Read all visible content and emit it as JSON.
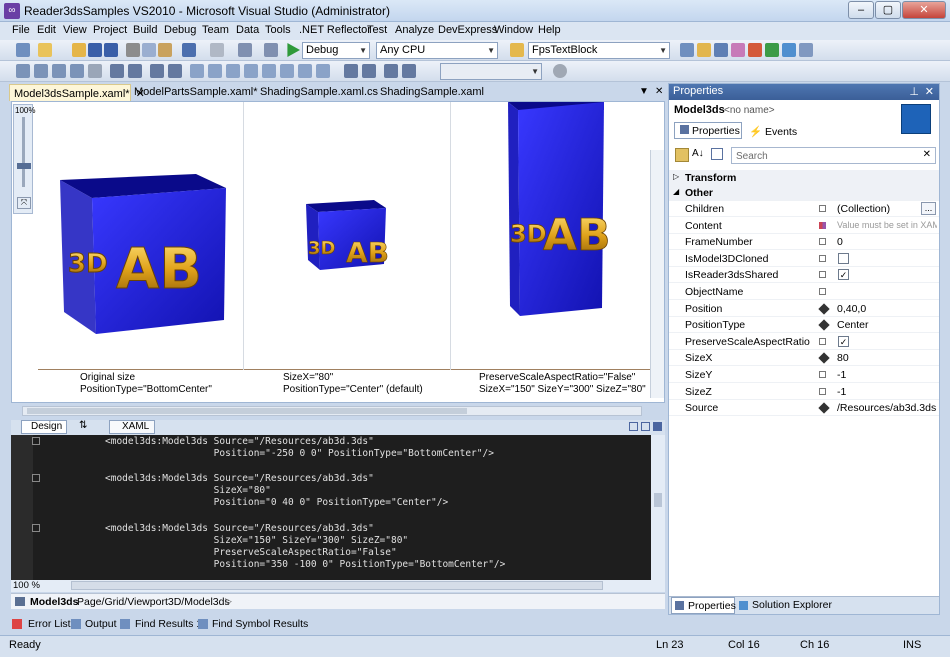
{
  "window": {
    "title": "Reader3dsSamples VS2010 - Microsoft Visual Studio (Administrator)",
    "min": "–",
    "max": "▢",
    "close": "✕"
  },
  "menu": [
    "File",
    "Edit",
    "View",
    "Project",
    "Build",
    "Debug",
    "Team",
    "Data",
    "Tools",
    ".NET Reflector",
    "Test",
    "Analyze",
    "DevExpress",
    "Window",
    "Help"
  ],
  "toolbar": {
    "config": "Debug",
    "platform": "Any CPU",
    "find": "FpsTextBlock"
  },
  "tabs": [
    "Model3dsSample.xaml*",
    "ModelPartsSample.xaml*",
    "ShadingSample.xaml.cs",
    "ShadingSample.xaml"
  ],
  "zoom_strip_label": "100%",
  "designer": {
    "captions": [
      [
        "Original size",
        "PositionType=\"BottomCenter\""
      ],
      [
        "SizeX=\"80\"",
        "PositionType=\"Center\" (default)"
      ],
      [
        "PreserveScaleAspectRatio=\"False\"",
        "SizeX=\"150\" SizeY=\"300\" SizeZ=\"80\""
      ]
    ],
    "cube_text": "AB",
    "cube_sub": "3D"
  },
  "viewtabs": {
    "design": "Design",
    "swap": "⇅",
    "xaml": "XAML"
  },
  "code": [
    {
      "text": "<model3ds:Model3ds Source=\"/Resources/ab3d.3ds\""
    },
    {
      "text": "                   Position=\"-250 0 0\" PositionType=\"BottomCenter\"/>"
    },
    {
      "text": "<model3ds:Model3ds Source=\"/Resources/ab3d.3ds\""
    },
    {
      "text": "                   SizeX=\"80\""
    },
    {
      "text": "                   Position=\"0 40 0\" PositionType=\"Center\"/>"
    },
    {
      "text": "<model3ds:Model3ds Source=\"/Resources/ab3d.3ds\""
    },
    {
      "text": "                   SizeX=\"150\" SizeY=\"300\" SizeZ=\"80\""
    },
    {
      "text": "                   PreserveScaleAspectRatio=\"False\""
    },
    {
      "text": "                   Position=\"350 -100 0\" PositionType=\"BottomCenter\"/>"
    }
  ],
  "code_zoom": "100 %",
  "breadcrumb": {
    "root": "Model3ds",
    "path": "Page/Grid/Viewport3D/Model3ds"
  },
  "properties": {
    "title": "Properties",
    "object": "Model3ds",
    "noname": "<no name>",
    "tab_props": "Properties",
    "tab_events": "Events",
    "search": "Search",
    "cat1": "Transform",
    "cat2": "Other",
    "rows": [
      {
        "name": "Children",
        "value": "(Collection)",
        "marker": "box"
      },
      {
        "name": "Content",
        "value": "Value must be set in XAML",
        "marker": "grid"
      },
      {
        "name": "FrameNumber",
        "value": "0",
        "marker": "box"
      },
      {
        "name": "IsModel3DCloned",
        "value": "",
        "marker": "box",
        "check": "empty"
      },
      {
        "name": "IsReader3dsShared",
        "value": "",
        "marker": "box",
        "check": "checked"
      },
      {
        "name": "ObjectName",
        "value": "",
        "marker": "box"
      },
      {
        "name": "Position",
        "value": "0,40,0",
        "marker": "dia"
      },
      {
        "name": "PositionType",
        "value": "Center",
        "marker": "dia"
      },
      {
        "name": "PreserveScaleAspectRatio",
        "value": "",
        "marker": "box",
        "check": "checked"
      },
      {
        "name": "SizeX",
        "value": "80",
        "marker": "dia"
      },
      {
        "name": "SizeY",
        "value": "-1",
        "marker": "box"
      },
      {
        "name": "SizeZ",
        "value": "-1",
        "marker": "box"
      },
      {
        "name": "Source",
        "value": "/Resources/ab3d.3ds",
        "marker": "dia"
      }
    ],
    "bottom_tab1": "Properties",
    "bottom_tab2": "Solution Explorer"
  },
  "bottom_tabs": [
    "Error List",
    "Output",
    "Find Results 1",
    "Find Symbol Results"
  ],
  "status": {
    "ready": "Ready",
    "ln": "Ln 23",
    "col": "Col 16",
    "ch": "Ch 16",
    "ins": "INS"
  }
}
